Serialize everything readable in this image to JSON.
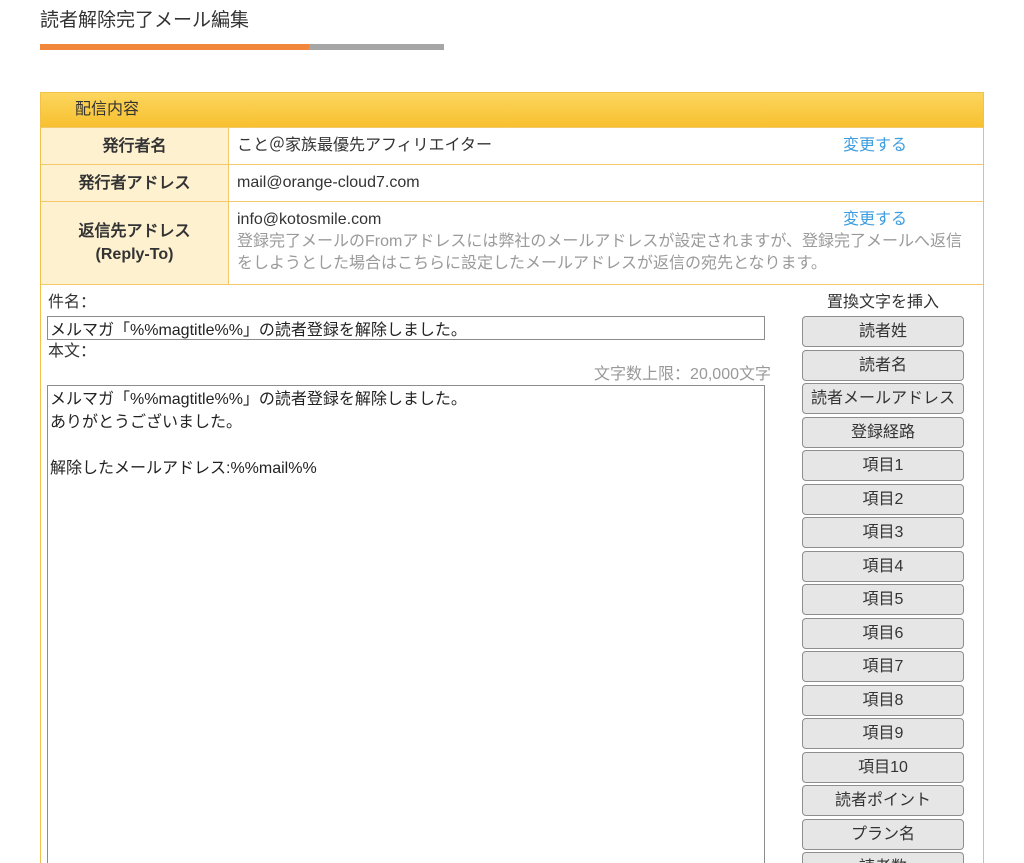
{
  "page": {
    "title": "読者解除完了メール編集"
  },
  "colors": {
    "accent": "#f0873a",
    "panel_border": "#f3c04a",
    "panel_header": "#f7c02f",
    "label_background": "#fdf1d0",
    "link": "#3d9de0"
  },
  "panel": {
    "header": "配信内容",
    "sender_name": {
      "label": "発行者名",
      "value": "こと＠家族最優先アフィリエイター",
      "action": "変更する"
    },
    "sender_address": {
      "label": "発行者アドレス",
      "value": "mail@orange-cloud7.com"
    },
    "reply_to": {
      "label": "返信先アドレス",
      "label_sub": "(Reply-To)",
      "value": "info@kotosmile.com",
      "action": "変更する",
      "note": "登録完了メールのFromアドレスには弊社のメールアドレスが設定されますが、登録完了メールへ返信をしようとした場合はこちらに設定したメールアドレスが返信の宛先となります。"
    }
  },
  "compose": {
    "subject_label": "件名：",
    "subject_value": "メルマガ「%%magtitle%%」の読者登録を解除しました。",
    "body_label": "本文：",
    "char_limit": "文字数上限：20,000文字",
    "body_value": "メルマガ「%%magtitle%%」の読者登録を解除しました。\nありがとうございました。\n\n解除したメールアドレス:%%mail%%"
  },
  "placeholders": {
    "title": "置換文字を挿入",
    "buttons": [
      "読者姓",
      "読者名",
      "読者メールアドレス",
      "登録経路",
      "項目1",
      "項目2",
      "項目3",
      "項目4",
      "項目5",
      "項目6",
      "項目7",
      "項目8",
      "項目9",
      "項目10",
      "読者ポイント",
      "プラン名",
      "読者数"
    ]
  }
}
